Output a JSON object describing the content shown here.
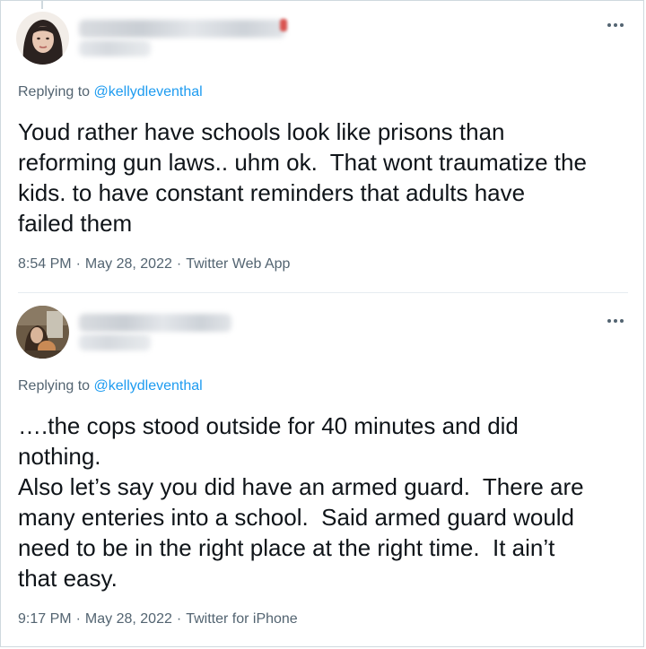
{
  "tweets": [
    {
      "author_name": "",
      "author_handle": "",
      "replying_prefix": "Replying to ",
      "replying_to": "@kellydleventhal",
      "text_lines": [
        "Youd rather have schools look like prisons than",
        "reforming gun laws.. uhm ok.  That wont traumatize the",
        "kids. to have constant reminders that adults have",
        "failed them"
      ],
      "time": "8:54 PM",
      "date": "May 28, 2022",
      "source": "Twitter Web App",
      "more_icon": "more-horizontal-icon"
    },
    {
      "author_name": "",
      "author_handle": "",
      "replying_prefix": "Replying to ",
      "replying_to": "@kellydleventhal",
      "text_lines": [
        "….the cops stood outside for 40 minutes and did",
        "nothing.",
        "Also let’s say you did have an armed guard.  There are",
        "many enteries into a school.  Said armed guard would",
        "need to be in the right place at the right time.  It ain’t",
        "that easy."
      ],
      "time": "9:17 PM",
      "date": "May 28, 2022",
      "source": "Twitter for iPhone",
      "more_icon": "more-horizontal-icon"
    }
  ],
  "separator": "·",
  "colors": {
    "text": "#0f1419",
    "secondary": "#536471",
    "link": "#1d9bf0",
    "border": "#cfd9de"
  }
}
